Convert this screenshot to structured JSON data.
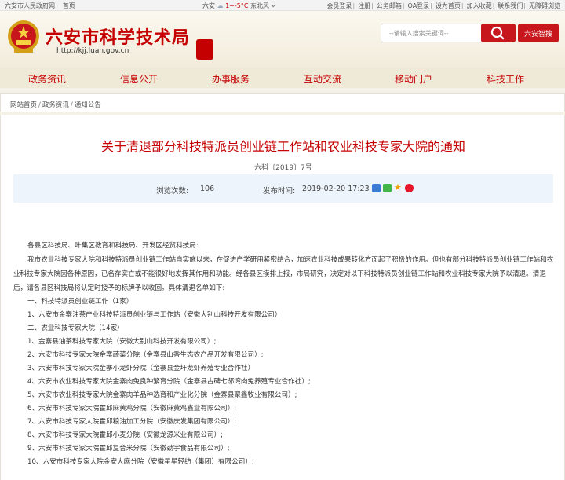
{
  "topbar": {
    "gov_link": "六安市人民政府网",
    "home_link": "首页",
    "city": "六安",
    "temperature": "1~-5°C",
    "wind": "东北风",
    "wind_arrow": "»",
    "links": [
      "会员登录",
      "注册",
      "公务邮箱",
      "OA登录",
      "设为首页",
      "加入收藏",
      "联系我们",
      "无障碍浏览"
    ]
  },
  "header": {
    "title": "六安市科学技术局",
    "url": "http://kjj.luan.gov.cn",
    "search_placeholder": "--请输入搜索关键词--",
    "smart_btn": "六安智搜"
  },
  "nav": [
    "政务资讯",
    "信息公开",
    "办事服务",
    "互动交流",
    "移动门户",
    "科技工作"
  ],
  "breadcrumb": [
    "网站首页",
    "政务资讯",
    "通知公告"
  ],
  "article": {
    "title": "关于清退部分科技特派员创业链工作站和农业科技专家大院的通知",
    "doc_number": "六科〔2019〕7号",
    "views_label": "浏览次数:",
    "views": "106",
    "date_label": "发布时间:",
    "date": "2019-02-20 17:23",
    "paragraphs": [
      "各县区科技局、叶集区教育和科技局、开发区经贸科技局:",
      "我市农业科技专家大院和科技特派员创业链工作站自实施以来，在促进产学研用紧密结合，加速农业科技成果转化方面起了积极的作用。但也有部分科技特派员创业链工作站和农业科技专家大院因各种原因，已名存实亡或不能很好地发挥其作用和功能。经各县区摸排上报，市局研究，决定对以下科技特派员创业链工作站和农业科技专家大院予以清退。清退后，请各县区科技局将认定时授予的标牌予以收回。具体清退名单如下:",
      "一、科技特派员创业链工作（1家）",
      "1、六安市金寨油茶产业科技特派员创业链与工作站（安徽大别山科技开发有限公司）",
      "二、农业科技专家大院（14家）",
      "1、金寨县油茶科技专家大院（安徽大别山科技开发有限公司）;",
      "2、六安市科技专家大院金寨蔬菜分院（金寨县山香生态农产品开发有限公司）;",
      "3、六安市科技专家大院金寨小龙虾分院（金寨县金圩龙虾养殖专业合作社）",
      "4、六安市农业科技专家大院金寨肉兔良种繁育分院（金寨县古碑七邻湾肉兔养殖专业合作社）;",
      "5、六安市农业科技专家大院金寨肉羊品种选育和产业化分院（金寨县聚鑫牧业有限公司）;",
      "6、六安市科技专家大院霍邱麻黄鸡分院（安徽麻黄鸡鑫业有限公司）;",
      "7、六安市科技专家大院霍邱粮油加工分院（安徽庆发集团有限公司）;",
      "8、六安市科技专家大院霍邱小麦分院（安徽龙源米业有限公司）;",
      "9、六安市科技专家大院霍邱复合米分院（安徽劲宇食品有限公司）;",
      "10、六安市科技专家大院金安大麻分院（安徽星星轻纺（集团）有限公司）;"
    ]
  },
  "colors": {
    "brand_red": "#c40000",
    "button_red": "#c8161d",
    "meta_bg": "#edf4fb"
  }
}
